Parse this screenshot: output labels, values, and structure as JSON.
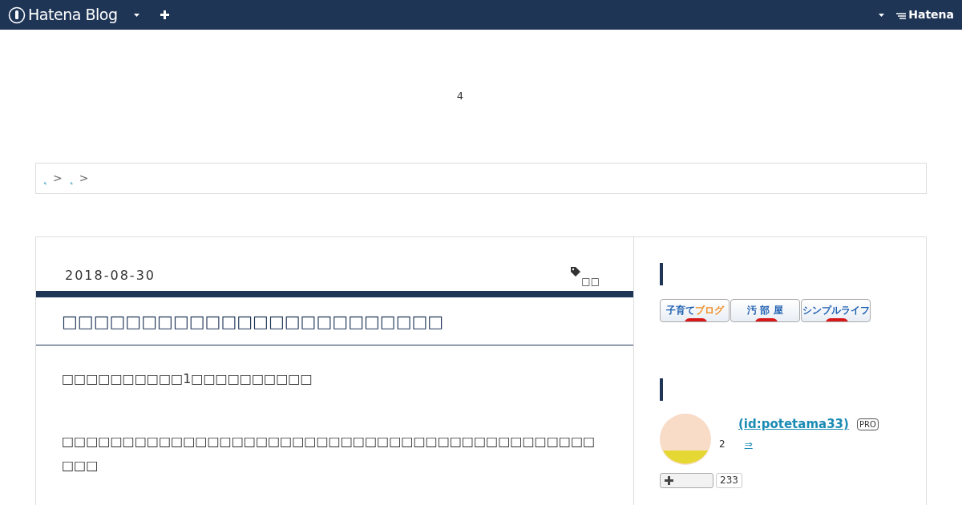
{
  "navbar": {
    "logo": "Hatena Blog",
    "brand": "Hatena"
  },
  "ad_count": "4",
  "breadcrumb": [
    {
      "label": "˛"
    },
    {
      "label": "˛"
    }
  ],
  "breadcrumb_separator": ">",
  "entry": {
    "date": "2018-08-30",
    "tags": "□□",
    "title": "□□□□□□□□□□□□□□□□□□□□□□□□",
    "paragraphs": [
      "□□□□□□□□□□1□□□□□□□□□□",
      "□□□□□□□□□□□□□□□□□□□□□□□□□□□□□□□□□□□□□□□□□□□□□□□"
    ]
  },
  "sidebar": {
    "ranking_badges": [
      {
        "parts": [
          "子育て",
          "ブログ"
        ]
      },
      {
        "parts": [
          "汚 部 屋"
        ]
      },
      {
        "parts": [
          "シンプルライフ"
        ]
      }
    ],
    "profile": {
      "id": "(id:potetama33)",
      "badge": "PRO",
      "count": "2",
      "link": "⇒",
      "follow_count": "233"
    }
  }
}
